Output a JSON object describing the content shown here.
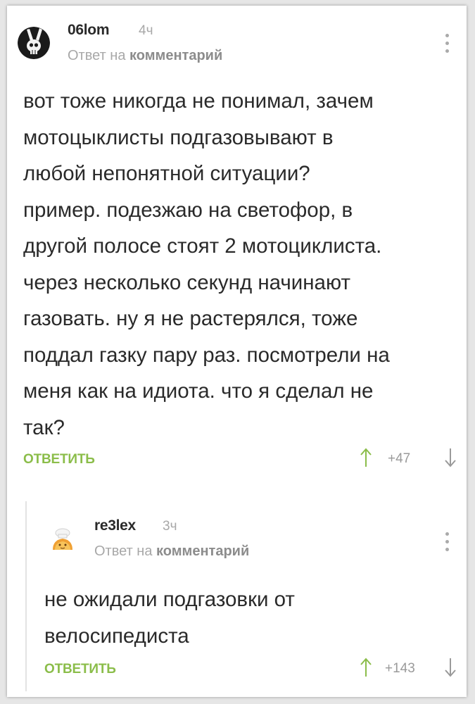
{
  "comments": [
    {
      "author": "06lom",
      "time": "4ч",
      "reply_prefix": "Ответ на",
      "reply_target": "комментарий",
      "text": "вот тоже никогда не понимал, зачем\nмотоцыклисты подгазовывают в\nлюбой непонятной ситуации?\nпример. подезжаю на светофор, в\nдругой полосе стоят 2 мотоциклиста.\nчерез несколько секунд начинают\nгазовать. ну я не растерялся, тоже\nподдал газку пару раз. посмотрели на\nменя как на идиота. что я сделал не\nтак?",
      "reply_label": "ОТВЕТИТЬ",
      "score": "+47",
      "avatar_icon": "bunny-skull-avatar"
    },
    {
      "author": "re3lex",
      "time": "3ч",
      "reply_prefix": "Ответ на",
      "reply_target": "комментарий",
      "text": "не ожидали подгазовки от\nвелосипедиста",
      "reply_label": "ОТВЕТИТЬ",
      "score": "+143",
      "avatar_icon": "chef-bread-avatar"
    }
  ],
  "colors": {
    "accent_green": "#8bbd4a",
    "muted": "#a8a8a8",
    "text": "#2a2a2a"
  }
}
